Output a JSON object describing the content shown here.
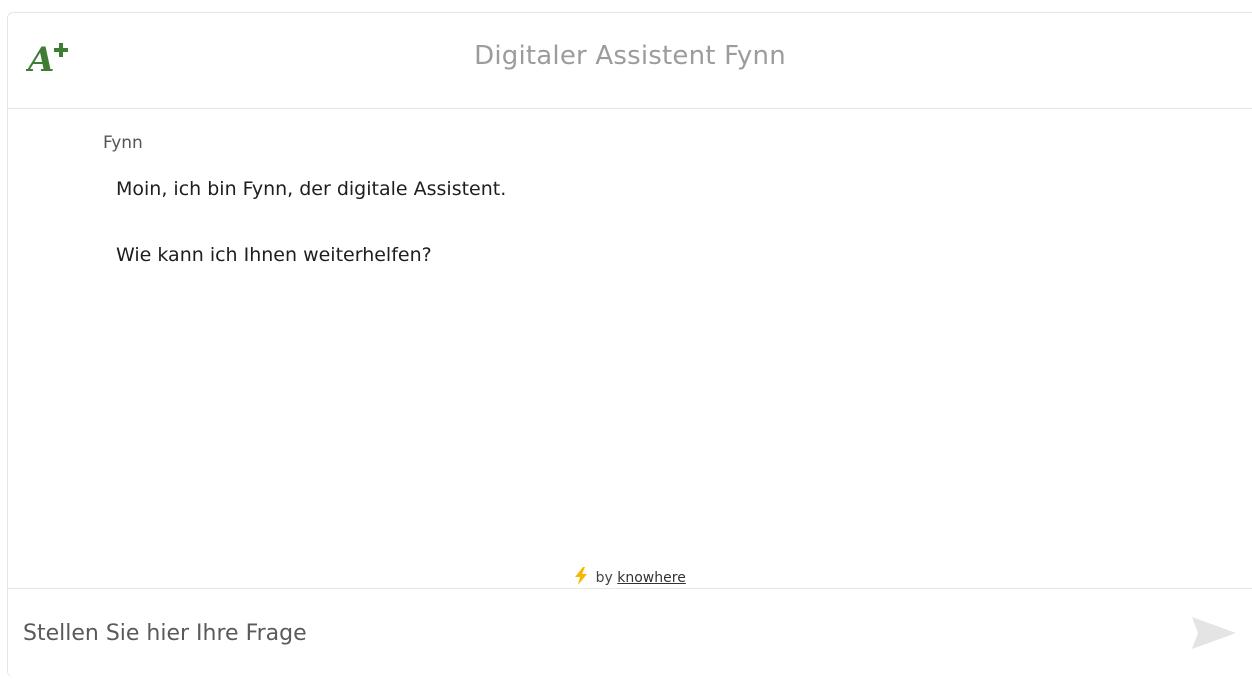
{
  "header": {
    "logo_icon": "gothic-a-plus-logo",
    "title": "Digitaler Assistent Fynn",
    "accent_color": "#3f7d35"
  },
  "chat": {
    "messages": [
      {
        "sender": "Fynn",
        "lines": [
          "Moin, ich bin Fynn, der digitale Assistent.",
          "Wie kann ich Ihnen weiterhelfen?"
        ]
      }
    ]
  },
  "powered_by": {
    "icon": "lightning-icon",
    "prefix": "by",
    "link_label": "knowhere",
    "icon_color": "#f5b800"
  },
  "input": {
    "placeholder": "Stellen Sie hier Ihre Frage",
    "value": "",
    "send_icon": "send-icon"
  }
}
